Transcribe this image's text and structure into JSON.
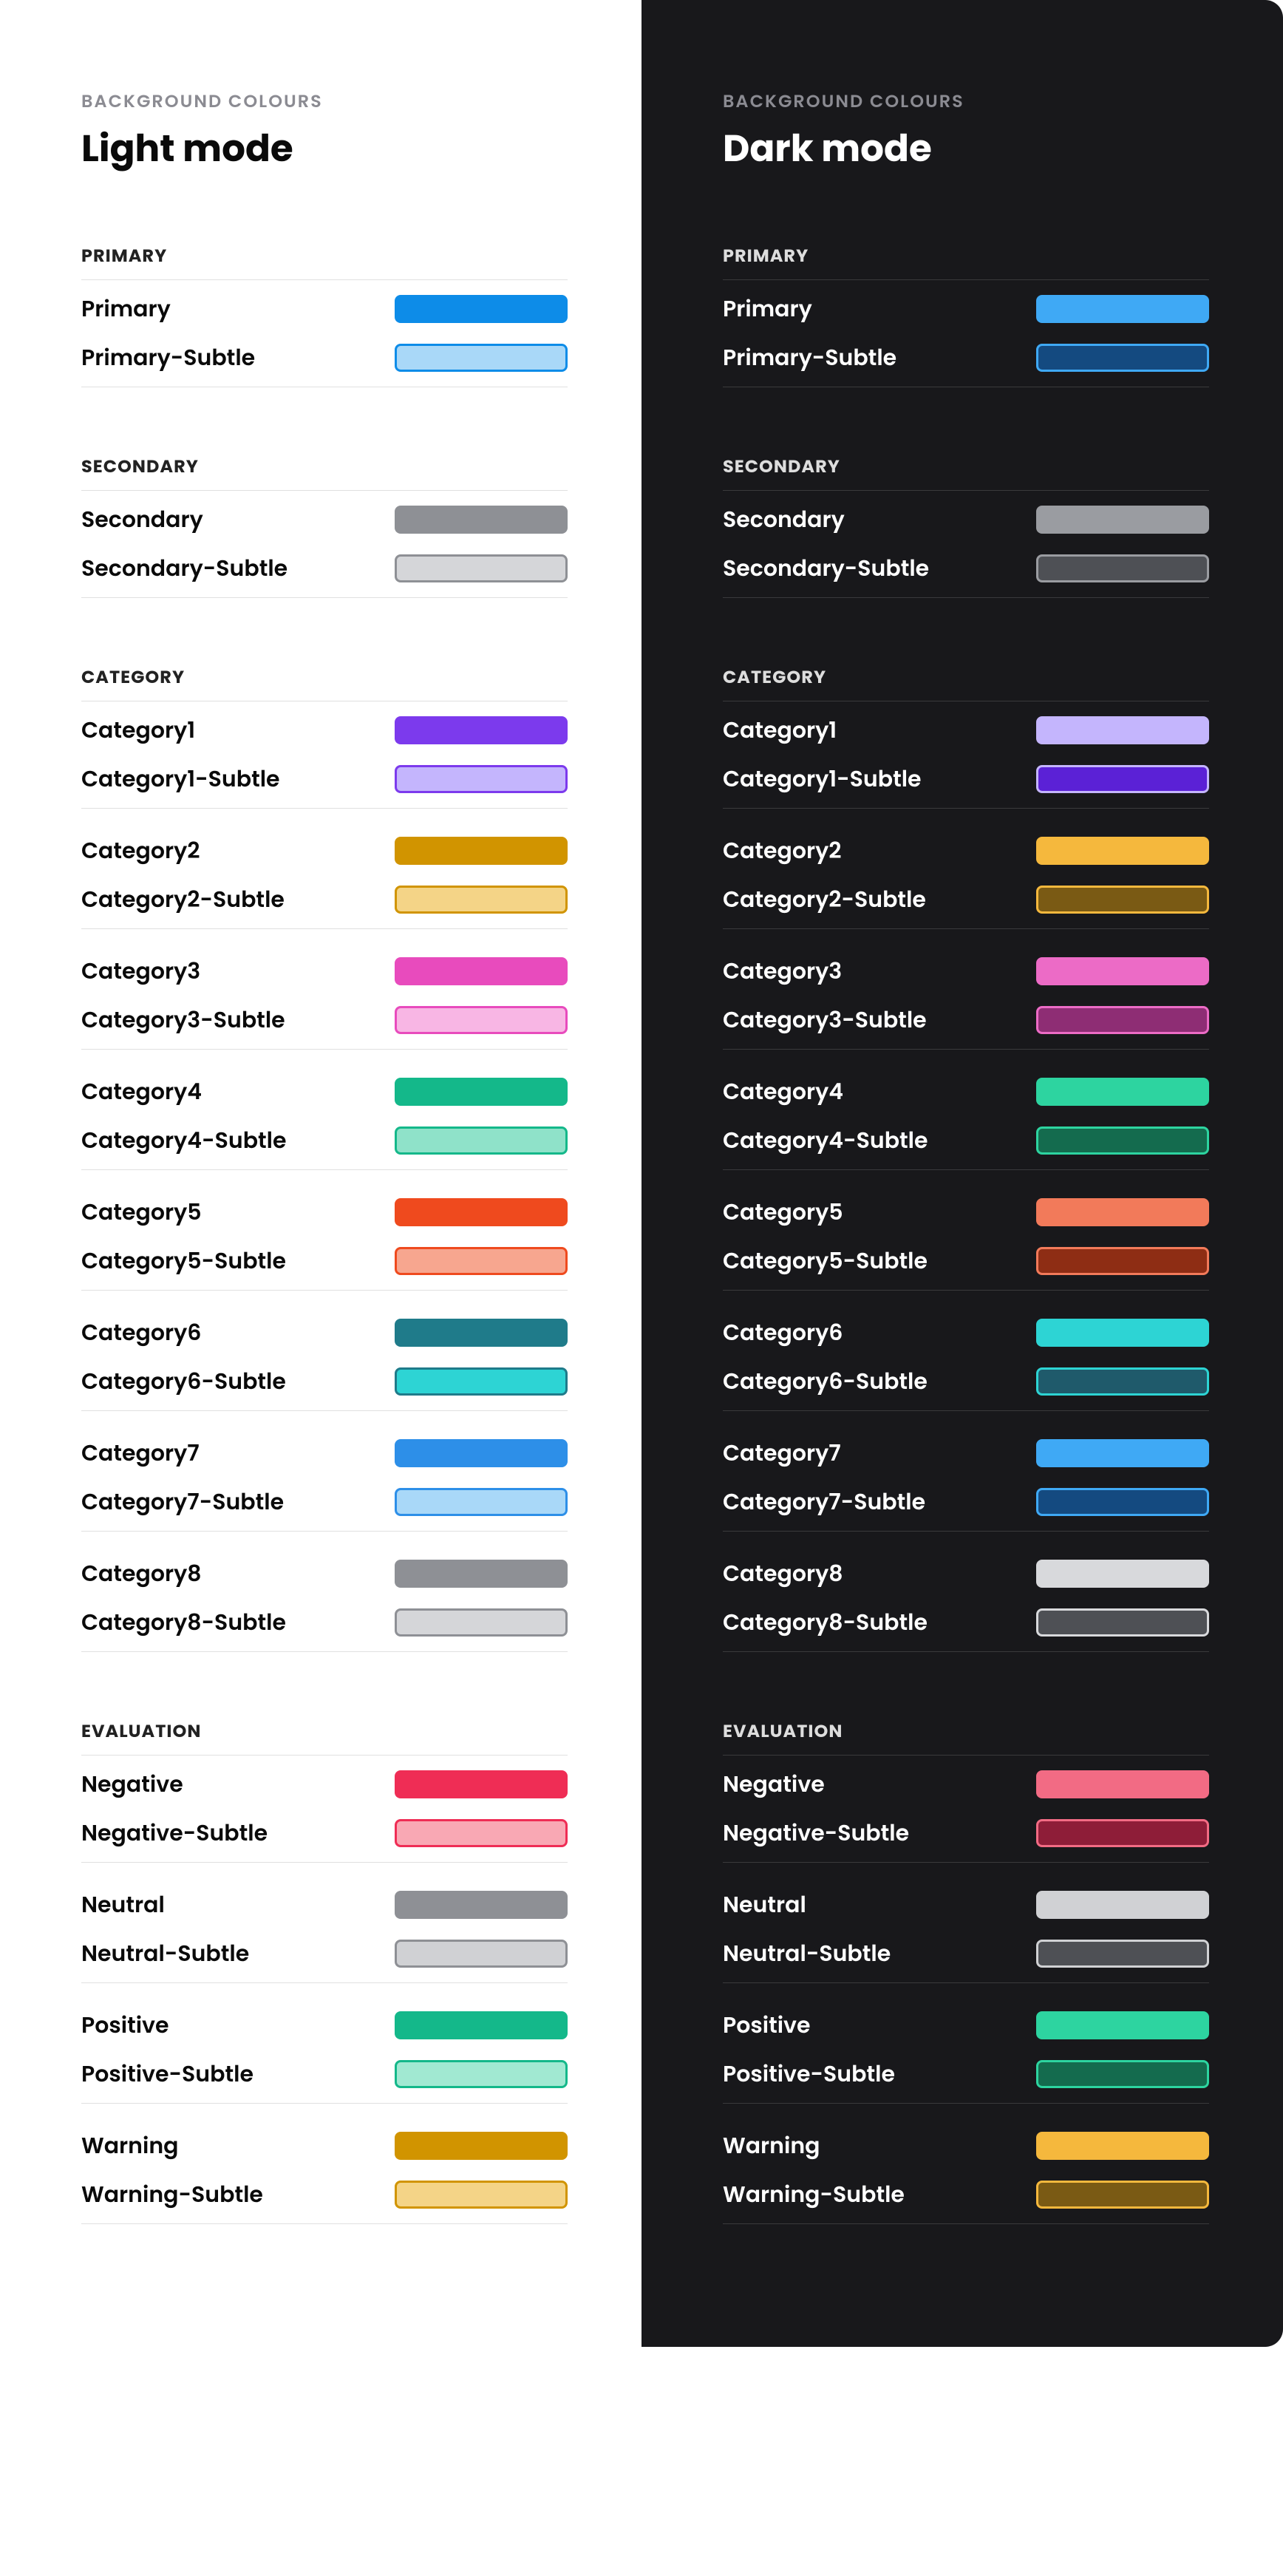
{
  "overline": "BACKGROUND COLOURS",
  "modes": {
    "light": {
      "title": "Light mode",
      "sections": [
        {
          "title": "PRIMARY",
          "groups": [
            [
              {
                "label": "Primary",
                "fill": "#0d8ce8",
                "border": null
              },
              {
                "label": "Primary-Subtle",
                "fill": "#a9d8f8",
                "border": "#0d8ce8"
              }
            ]
          ]
        },
        {
          "title": "SECONDARY",
          "groups": [
            [
              {
                "label": "Secondary",
                "fill": "#8e9095",
                "border": null
              },
              {
                "label": "Secondary-Subtle",
                "fill": "#d5d6d9",
                "border": "#8e9095"
              }
            ]
          ]
        },
        {
          "title": "CATEGORY",
          "groups": [
            [
              {
                "label": "Category1",
                "fill": "#7c3aed",
                "border": null
              },
              {
                "label": "Category1-Subtle",
                "fill": "#c4b5fd",
                "border": "#7c3aed"
              }
            ],
            [
              {
                "label": "Category2",
                "fill": "#d19400",
                "border": null
              },
              {
                "label": "Category2-Subtle",
                "fill": "#f4d487",
                "border": "#d19400"
              }
            ],
            [
              {
                "label": "Category3",
                "fill": "#e84bbd",
                "border": null
              },
              {
                "label": "Category3-Subtle",
                "fill": "#f8b6e4",
                "border": "#e84bbd"
              }
            ],
            [
              {
                "label": "Category4",
                "fill": "#14b88a",
                "border": null
              },
              {
                "label": "Category4-Subtle",
                "fill": "#8fe2c9",
                "border": "#14b88a"
              }
            ],
            [
              {
                "label": "Category5",
                "fill": "#ef4a1e",
                "border": null
              },
              {
                "label": "Category5-Subtle",
                "fill": "#f7a68f",
                "border": "#ef4a1e"
              }
            ],
            [
              {
                "label": "Category6",
                "fill": "#1f7b8a",
                "border": null
              },
              {
                "label": "Category6-Subtle",
                "fill": "#2dd4d4",
                "border": "#1f7b8a"
              }
            ],
            [
              {
                "label": "Category7",
                "fill": "#2d8fe8",
                "border": null
              },
              {
                "label": "Category7-Subtle",
                "fill": "#a9d8f8",
                "border": "#2d8fe8"
              }
            ],
            [
              {
                "label": "Category8",
                "fill": "#8e9095",
                "border": null
              },
              {
                "label": "Category8-Subtle",
                "fill": "#d5d6d9",
                "border": "#8e9095"
              }
            ]
          ]
        },
        {
          "title": "EVALUATION",
          "groups": [
            [
              {
                "label": "Negative",
                "fill": "#ef2d55",
                "border": null
              },
              {
                "label": "Negative-Subtle",
                "fill": "#f9a8b4",
                "border": "#ef2d55"
              }
            ],
            [
              {
                "label": "Neutral",
                "fill": "#8e9095",
                "border": null
              },
              {
                "label": "Neutral-Subtle",
                "fill": "#d0d1d4",
                "border": "#8e9095"
              }
            ],
            [
              {
                "label": "Positive",
                "fill": "#14b88a",
                "border": null
              },
              {
                "label": "Positive-Subtle",
                "fill": "#a1e9d2",
                "border": "#14b88a"
              }
            ],
            [
              {
                "label": "Warning",
                "fill": "#d19400",
                "border": null
              },
              {
                "label": "Warning-Subtle",
                "fill": "#f4d487",
                "border": "#d19400"
              }
            ]
          ]
        }
      ]
    },
    "dark": {
      "title": "Dark mode",
      "sections": [
        {
          "title": "PRIMARY",
          "groups": [
            [
              {
                "label": "Primary",
                "fill": "#3fa9f5",
                "border": null
              },
              {
                "label": "Primary-Subtle",
                "fill": "#144a80",
                "border": "#3fa9f5"
              }
            ]
          ]
        },
        {
          "title": "SECONDARY",
          "groups": [
            [
              {
                "label": "Secondary",
                "fill": "#9a9ca1",
                "border": null
              },
              {
                "label": "Secondary-Subtle",
                "fill": "#4e5055",
                "border": "#9a9ca1"
              }
            ]
          ]
        },
        {
          "title": "CATEGORY",
          "groups": [
            [
              {
                "label": "Category1",
                "fill": "#c4b5fd",
                "border": null
              },
              {
                "label": "Category1-Subtle",
                "fill": "#5b21d6",
                "border": "#c4b5fd"
              }
            ],
            [
              {
                "label": "Category2",
                "fill": "#f5b83d",
                "border": null
              },
              {
                "label": "Category2-Subtle",
                "fill": "#7a5a14",
                "border": "#f5b83d"
              }
            ],
            [
              {
                "label": "Category3",
                "fill": "#ec6bc6",
                "border": null
              },
              {
                "label": "Category3-Subtle",
                "fill": "#8e2d74",
                "border": "#ec6bc6"
              }
            ],
            [
              {
                "label": "Category4",
                "fill": "#2dd4a0",
                "border": null
              },
              {
                "label": "Category4-Subtle",
                "fill": "#146b4e",
                "border": "#2dd4a0"
              }
            ],
            [
              {
                "label": "Category5",
                "fill": "#f27a5a",
                "border": null
              },
              {
                "label": "Category5-Subtle",
                "fill": "#8e2d14",
                "border": "#f27a5a"
              }
            ],
            [
              {
                "label": "Category6",
                "fill": "#2dd4d4",
                "border": null
              },
              {
                "label": "Category6-Subtle",
                "fill": "#1f5a6b",
                "border": "#2dd4d4"
              }
            ],
            [
              {
                "label": "Category7",
                "fill": "#3fa9f5",
                "border": null
              },
              {
                "label": "Category7-Subtle",
                "fill": "#144a80",
                "border": "#3fa9f5"
              }
            ],
            [
              {
                "label": "Category8",
                "fill": "#d8d9dc",
                "border": null
              },
              {
                "label": "Category8-Subtle",
                "fill": "#4e5055",
                "border": "#d8d9dc"
              }
            ]
          ]
        },
        {
          "title": "EVALUATION",
          "groups": [
            [
              {
                "label": "Negative",
                "fill": "#f26b84",
                "border": null
              },
              {
                "label": "Negative-Subtle",
                "fill": "#8e1d38",
                "border": "#f26b84"
              }
            ],
            [
              {
                "label": "Neutral",
                "fill": "#d0d1d4",
                "border": null
              },
              {
                "label": "Neutral-Subtle",
                "fill": "#4e5055",
                "border": "#d0d1d4"
              }
            ],
            [
              {
                "label": "Positive",
                "fill": "#2dd4a0",
                "border": null
              },
              {
                "label": "Positive-Subtle",
                "fill": "#146b4e",
                "border": "#2dd4a0"
              }
            ],
            [
              {
                "label": "Warning",
                "fill": "#f5b83d",
                "border": null
              },
              {
                "label": "Warning-Subtle",
                "fill": "#7a5a14",
                "border": "#f5b83d"
              }
            ]
          ]
        }
      ]
    }
  }
}
